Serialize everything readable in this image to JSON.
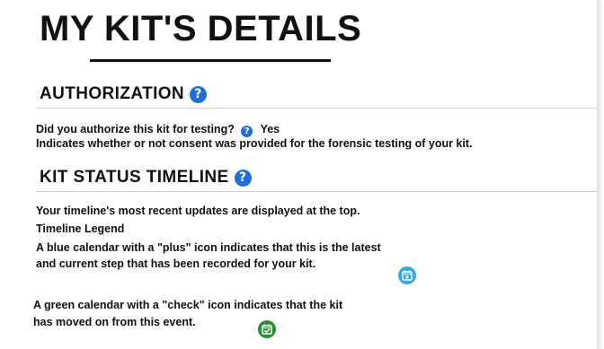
{
  "page": {
    "title": "MY KIT'S DETAILS"
  },
  "authorization": {
    "heading": "AUTHORIZATION",
    "help_icon": "question-circle-icon",
    "question": "Did you authorize this kit for testing?",
    "answer": "Yes",
    "description": "Indicates whether or not consent was provided for the forensic testing of your kit."
  },
  "timeline": {
    "heading": "KIT STATUS TIMELINE",
    "help_icon": "question-circle-icon",
    "intro": "Your timeline's most recent updates are displayed at the top.",
    "legend_title": "Timeline Legend",
    "blue_line1": "A blue calendar with a \"plus\" icon indicates that this is the latest",
    "blue_line2": "and current step that has been recorded for your kit.",
    "blue_icon": "calendar-plus-icon",
    "green_line1": "A green calendar with a \"check\" icon indicates that the kit",
    "green_line2": "has moved on from this event.",
    "green_icon": "calendar-check-icon"
  },
  "colors": {
    "help_icon": "#1f6fd6",
    "blue_calendar": "#3aa7e0",
    "green_calendar": "#2e8b3a",
    "text": "#111111"
  }
}
